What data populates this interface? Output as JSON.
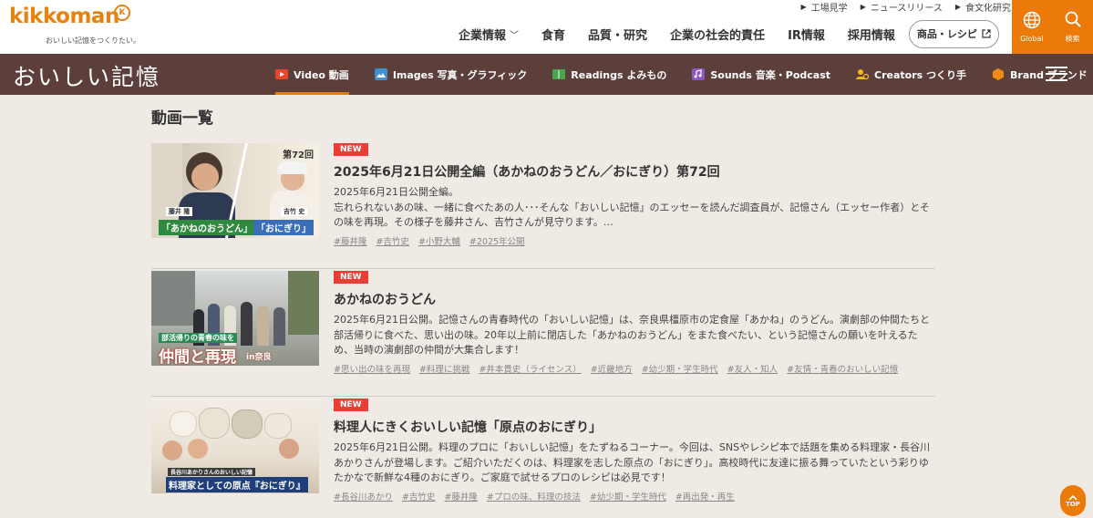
{
  "header": {
    "logo_text": "kikkoman",
    "logo_mark": "K",
    "tagline": "おいしい記憶をつくりたい。",
    "util_links": [
      "工場見学",
      "ニュースリリース",
      "食文化研究"
    ],
    "nav": [
      {
        "label": "企業情報",
        "has_dropdown": true
      },
      {
        "label": "食育",
        "has_dropdown": false
      },
      {
        "label": "品質・研究",
        "has_dropdown": false
      },
      {
        "label": "企業の社会的責任",
        "has_dropdown": false
      },
      {
        "label": "IR情報",
        "has_dropdown": false
      },
      {
        "label": "採用情報",
        "has_dropdown": false
      }
    ],
    "product_button": "商品・レシピ",
    "global_label": "Global",
    "search_label": "検索",
    "accent_color": "#ec7a08"
  },
  "brand_bar": {
    "title": "おいしい記憶",
    "categories": [
      {
        "label": "Video 動画",
        "icon": "video-icon",
        "active": true,
        "color": "#e8452c"
      },
      {
        "label": "Images 写真・グラフィック",
        "icon": "image-icon",
        "active": false,
        "color": "#3d8fd6"
      },
      {
        "label": "Readings よみもの",
        "icon": "book-icon",
        "active": false,
        "color": "#4aa54e"
      },
      {
        "label": "Sounds 音楽・Podcast",
        "icon": "sound-icon",
        "active": false,
        "color": "#8c57c9"
      },
      {
        "label": "Creators つくり手",
        "icon": "creators-icon",
        "active": false,
        "color": "#f2b81c"
      },
      {
        "label": "Brand ブランド",
        "icon": "brand-icon",
        "active": false,
        "color": "#f08a12"
      }
    ]
  },
  "main": {
    "page_title": "動画一覧",
    "videos": [
      {
        "badge": "NEW",
        "title": "2025年6月21日公開全編（あかねのおうどん／おにぎり）第72回",
        "description": "2025年6月21日公開全編。\n忘れられないあの味、一緒に食べたあの人･･･そんな「おいしい記憶」のエッセーを読んだ調査員が、記憶さん（エッセー作者）とその味を再現。その様子を藤井さん、吉竹さんが見守ります。…",
        "tags": [
          "#藤井隆",
          "#吉竹史",
          "#小野大輔",
          "#2025年公開"
        ],
        "thumb_caption": "「あかねのおうどん」",
        "thumb_caption2": "「おにぎり」",
        "thumb_episode": "第72回",
        "thumb_name1": "藤井 隆",
        "thumb_name2": "吉竹 史"
      },
      {
        "badge": "NEW",
        "title": "あかねのおうどん",
        "description": "2025年6月21日公開。記憶さんの青春時代の「おいしい記憶」は、奈良県橿原市の定食屋「あかね」のうどん。演劇部の仲間たちと部活帰りに食べた、思い出の味。20年以上前に閉店した「あかねのおうどん」をまた食べたい、という記憶さんの願いを叶えるため、当時の演劇部の仲間が大集合します！",
        "tags": [
          "#思い出の味を再現",
          "#料理に挑戦",
          "#井本貴史（ライセンス）",
          "#近畿地方",
          "#幼少期・学生時代",
          "#友人・知人",
          "#友情・青春のおいしい記憶"
        ],
        "thumb_caption": "仲間と再現",
        "thumb_caption_small": "部活帰りの青春の味を",
        "thumb_place": "in奈良"
      },
      {
        "badge": "NEW",
        "title": "料理人にきくおいしい記憶「原点のおにぎり」",
        "description": "2025年6月21日公開。料理のプロに「おいしい記憶」をたずねるコーナー。今回は、SNSやレシピ本で話題を集める料理家・長谷川あかりさんが登場します。ご紹介いただくのは、料理家を志した原点の「おにぎり」。高校時代に友達に振る舞っていたという彩りゆたかなで新鮮な4種のおにぎり。ご家庭で試せるプロのレシピは必見です！",
        "tags": [
          "#長谷川あかり",
          "#吉竹史",
          "#藤井隆",
          "#プロの味、料理の技法",
          "#幼少期・学生時代",
          "#再出発・再生"
        ],
        "thumb_caption": "料理家としての原点『おにぎり』",
        "thumb_caption_small": "長谷川あかりさんのおいしい記憶"
      }
    ]
  },
  "top_button": "TOP"
}
